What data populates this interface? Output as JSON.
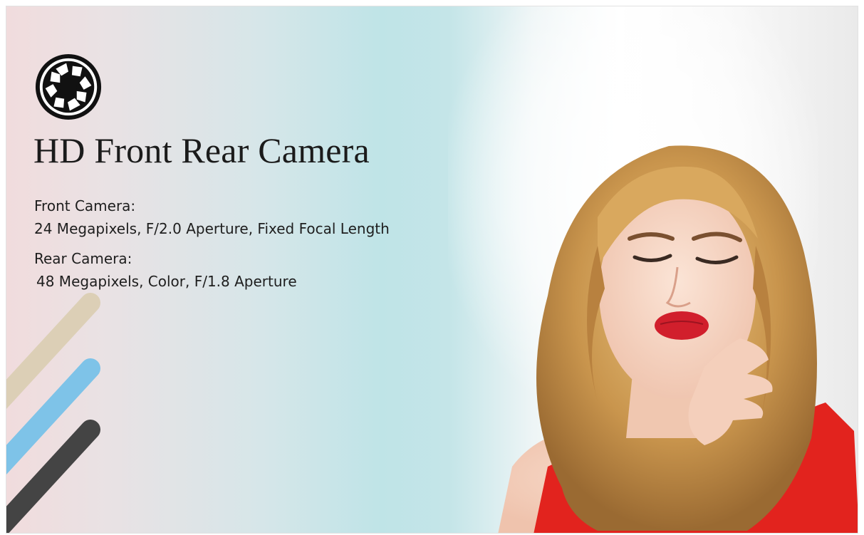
{
  "banner": {
    "title": "HD Front Rear Camera",
    "front": {
      "label": "Front Camera:",
      "value": "24 Megapixels, F/2.0 Aperture, Fixed Focal Length"
    },
    "rear": {
      "label": "Rear Camera:",
      "value": "48 Megapixels, Color, F/1.8 Aperture"
    },
    "icon": "camera-aperture-icon",
    "colors": {
      "stripe_beige": "#dccfb6",
      "stripe_blue": "#7ec3e8",
      "stripe_dark": "#444444",
      "text": "#1e1e1e",
      "lips": "#d11f2c",
      "dress": "#e2231e"
    }
  }
}
